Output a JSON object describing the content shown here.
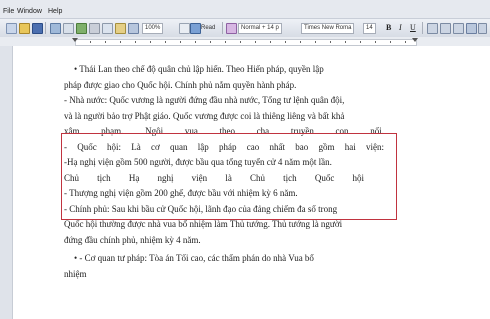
{
  "menu": [
    "File",
    "Window",
    "Help"
  ],
  "toolbar": {
    "zoom": "100%",
    "read_label": "Read",
    "style_value": "Normal + 14 p",
    "font_value": "Times New Roma",
    "size_value": "14",
    "bold": "B",
    "italic": "I",
    "underline": "U"
  },
  "colors": {
    "highlight_border": "#c0333f",
    "chrome": "#dfe3ea"
  },
  "document": {
    "lines": [
      "•   Thái Lan theo chế độ quân chủ lập hiến. Theo Hiến pháp, quyền lập",
      "pháp được giao cho Quốc hội. Chính phủ nắm quyền hành pháp.",
      "- Nhà nước: Quốc vương là người đứng đầu nhà nước, Tổng tư lệnh quân đội,",
      "và là người bảo trợ Phật giáo. Quốc vương được coi là thiêng liêng và bất khả",
      "xâm phạm. Ngôi vua theo cha truyền con nối.",
      "- Quốc hội: Là cơ quan lập pháp cao nhất bao gồm hai viện:",
      "-Hạ nghị viện gồm 500 người, được bầu qua tổng tuyển cử 4 năm một lần.",
      "Chủ tịch Hạ nghị viện là Chủ tịch Quốc hội",
      "- Thượng nghị viện gồm 200 ghế, được bầu với nhiệm kỳ 6 năm.",
      "- Chính phủ: Sau khi bầu cử Quốc hội, lãnh đạo của đảng chiếm đa số trong",
      "Quốc hội thường được nhà vua bổ nhiệm làm Thủ tướng. Thủ tướng là người",
      "đứng đầu chính phủ, nhiệm kỳ 4 năm.",
      "•   - Cơ quan tư pháp: Tòa án Tối cao, các thẩm phán do nhà Vua bổ",
      "nhiệm"
    ]
  }
}
